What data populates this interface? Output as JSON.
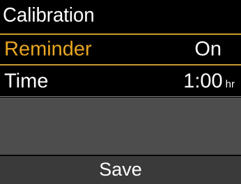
{
  "header": {
    "title": "Calibration"
  },
  "settings": {
    "reminder": {
      "label": "Reminder",
      "value": "On"
    },
    "time": {
      "label": "Time",
      "value": "1:00",
      "unit": "hr"
    }
  },
  "actions": {
    "save_label": "Save"
  },
  "colors": {
    "selected_text": "#e9a623",
    "selected_border": "#c89b2c",
    "empty_area": "#4d4d4d",
    "save_bar": "#3a3a3a"
  }
}
